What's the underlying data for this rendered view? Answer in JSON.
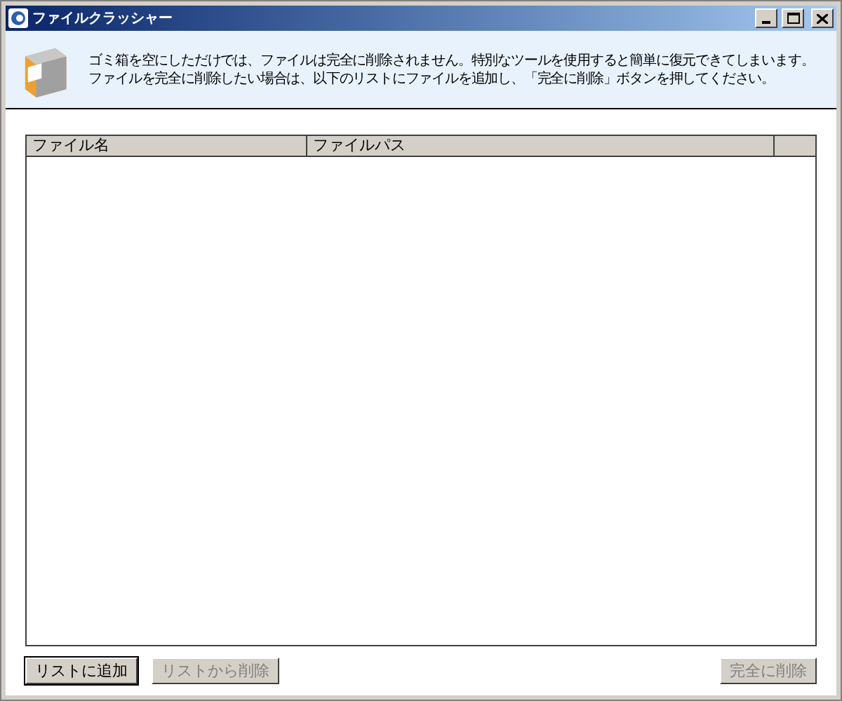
{
  "window": {
    "title": "ファイルクラッシャー"
  },
  "description": "ゴミ箱を空にしただけでは、ファイルは完全に削除されません。特別なツールを使用すると簡単に復元できてしまいます。ファイルを完全に削除したい場合は、以下のリストにファイルを追加し、「完全に削除」ボタンを押してください。",
  "table": {
    "columns": [
      "ファイル名",
      "ファイルパス"
    ]
  },
  "buttons": [
    {
      "label": "リストに追加",
      "disabled": false,
      "focused": true
    },
    {
      "label": "リストから削除",
      "disabled": true,
      "focused": false
    },
    {
      "label": "完全に削除",
      "disabled": true,
      "focused": false
    }
  ]
}
